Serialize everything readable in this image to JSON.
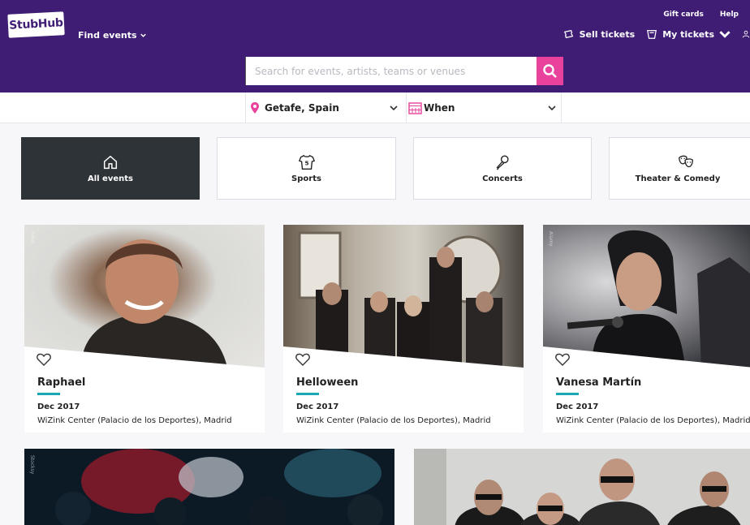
{
  "header": {
    "logo": "StubHub",
    "find_events": "Find events",
    "gift_cards": "Gift cards",
    "help": "Help",
    "sell_tickets": "Sell tickets",
    "my_tickets": "My tickets",
    "search_placeholder": "Search for events, artists, teams or venues"
  },
  "filters": {
    "location": "Getafe, Spain",
    "when": "When"
  },
  "categories": [
    {
      "label": "All events",
      "icon": "home-icon",
      "active": true
    },
    {
      "label": "Sports",
      "icon": "jersey-icon",
      "active": false
    },
    {
      "label": "Concerts",
      "icon": "microphone-icon",
      "active": false
    },
    {
      "label": "Theater & Comedy",
      "icon": "theater-masks-icon",
      "active": false
    }
  ],
  "events": [
    {
      "name": "Raphael",
      "date": "Dec 2017",
      "venue": "WiZink Center (Palacio de los Deportes), Madrid"
    },
    {
      "name": "Helloween",
      "date": "Dec 2017",
      "venue": "WiZink Center (Palacio de los Deportes), Madrid"
    },
    {
      "name": "Vanesa Martín",
      "date": "Dec 2017",
      "venue": "WiZink Center (Palacio de los Deportes), Madrid"
    }
  ],
  "colors": {
    "brand_purple": "#3f1d74",
    "search_pink": "#e8429d",
    "accent_teal": "#17a7b5",
    "active_tile": "#2e3337"
  }
}
